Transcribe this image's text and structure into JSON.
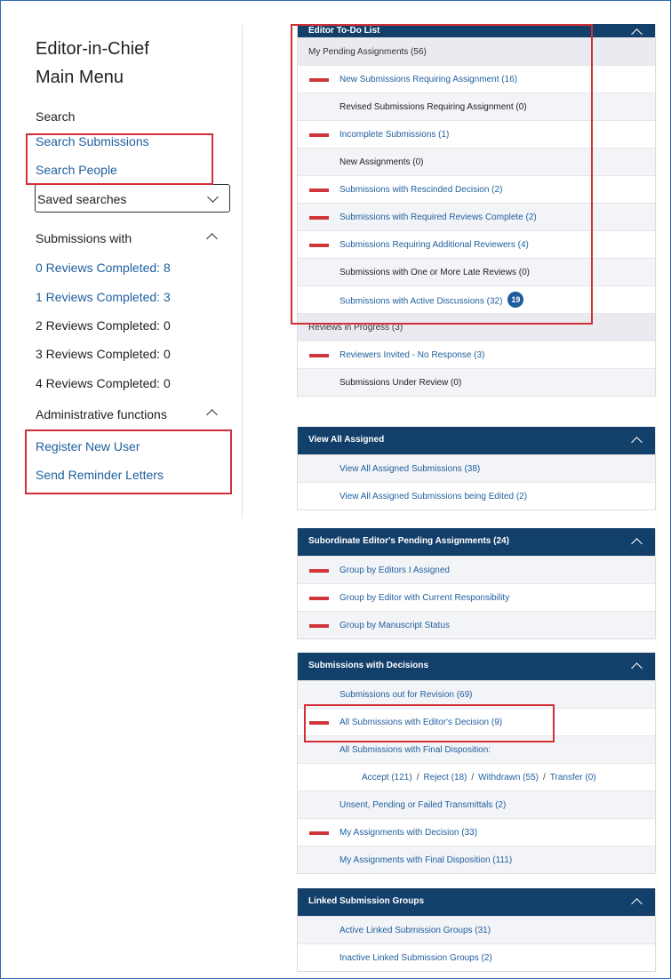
{
  "menu": {
    "title_line1": "Editor-in-Chief",
    "title_line2": "Main Menu"
  },
  "search": {
    "heading": "Search",
    "links": [
      "Search Submissions",
      "Search People"
    ]
  },
  "saved_searches": {
    "label": "Saved searches",
    "icon": "chevron-down-icon"
  },
  "submissions_with": {
    "heading": "Submissions with",
    "items": [
      {
        "label": "0 Reviews Completed: 8",
        "link": true
      },
      {
        "label": "1 Reviews Completed: 3",
        "link": true
      },
      {
        "label": "2 Reviews Completed: 0",
        "link": false
      },
      {
        "label": "3 Reviews Completed: 0",
        "link": false
      },
      {
        "label": "4 Reviews Completed: 0",
        "link": false
      }
    ]
  },
  "admin": {
    "heading": "Administrative functions",
    "links": [
      "Register New User",
      "Send Reminder Letters"
    ]
  },
  "todo": {
    "title": "Editor To-Do List",
    "pending_heading": "My Pending Assignments (56)",
    "pending": [
      {
        "label": "New Submissions Requiring Assignment (16)",
        "flag": true,
        "link": true
      },
      {
        "label": "Revised Submissions Requiring Assignment (0)",
        "flag": false,
        "link": false
      },
      {
        "label": "Incomplete Submissions (1)",
        "flag": true,
        "link": true
      },
      {
        "label": "New Assignments (0)",
        "flag": false,
        "link": false
      },
      {
        "label": "Submissions with Rescinded Decision (2)",
        "flag": true,
        "link": true
      },
      {
        "label": "Submissions with Required Reviews Complete (2)",
        "flag": true,
        "link": true
      },
      {
        "label": "Submissions Requiring Additional Reviewers (4)",
        "flag": true,
        "link": true
      },
      {
        "label": "Submissions with One or More Late Reviews (0)",
        "flag": false,
        "link": false
      },
      {
        "label": "Submissions with Active Discussions (32)",
        "flag": false,
        "link": true,
        "badge": "19"
      }
    ],
    "reviews_heading": "Reviews in Progress (3)",
    "reviews": [
      {
        "label": "Reviewers Invited - No Response (3)",
        "flag": true,
        "link": true
      },
      {
        "label": "Submissions Under Review (0)",
        "flag": false,
        "link": false
      }
    ]
  },
  "view_all": {
    "title": "View All Assigned",
    "rows": [
      "View All Assigned Submissions (38)",
      "View All Assigned Submissions being Edited (2)"
    ]
  },
  "subordinate": {
    "title": "Subordinate Editor's Pending Assignments (24)",
    "rows": [
      "Group by Editors I Assigned",
      "Group by Editor with Current Responsibility",
      "Group by Manuscript Status"
    ]
  },
  "decisions": {
    "title": "Submissions with Decisions",
    "rows": [
      {
        "label": "Submissions out for Revision (69)",
        "flag": false
      },
      {
        "label": "All Submissions with Editor's Decision (9)",
        "flag": true
      },
      {
        "label": "All Submissions with Final Disposition:",
        "flag": false
      }
    ],
    "disposition": [
      "Accept (121)",
      "Reject (18)",
      "Withdrawn (55)",
      "Transfer (0)"
    ],
    "separator": "/",
    "rows2": [
      {
        "label": "Unsent, Pending or Failed Transmittals (2)",
        "flag": false
      },
      {
        "label": "My Assignments with Decision (33)",
        "flag": true
      },
      {
        "label": "My Assignments with Final Disposition (111)",
        "flag": false
      }
    ]
  },
  "linked": {
    "title": "Linked Submission Groups",
    "rows": [
      "Active Linked Submission Groups (31)",
      "Inactive Linked Submission Groups (2)"
    ]
  },
  "colors": {
    "header_bg": "#133f6b",
    "link": "#1f5f9e",
    "flag": "#d0353b",
    "highlight": "#d32f36",
    "badge": "#1c5c9c"
  }
}
